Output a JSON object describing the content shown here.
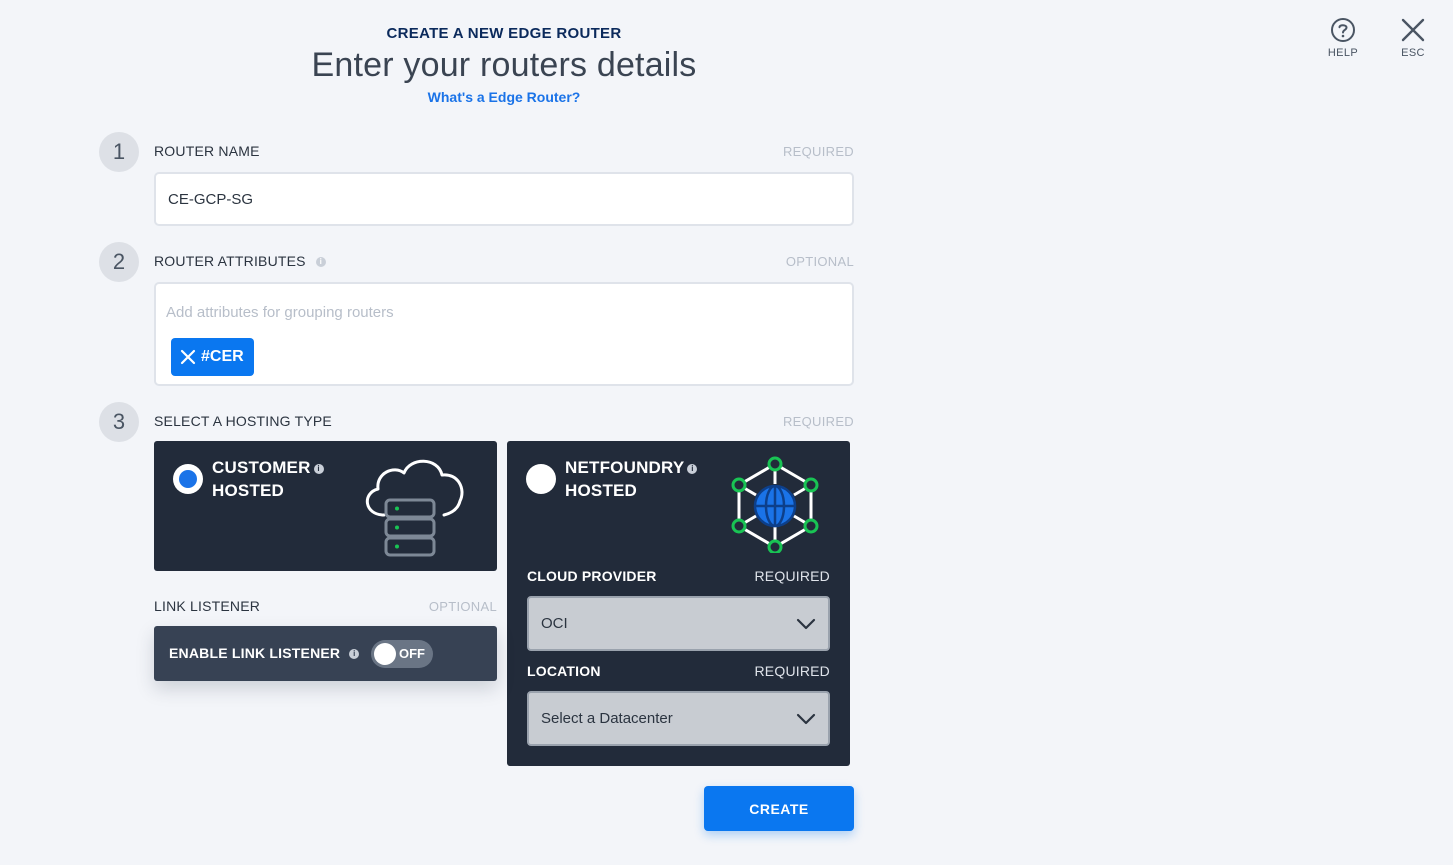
{
  "header": {
    "kicker": "CREATE A NEW EDGE ROUTER",
    "title": "Enter your routers details",
    "help_link": "What's a Edge Router?"
  },
  "corner": {
    "help_label": "HELP",
    "esc_label": "ESC"
  },
  "steps": [
    {
      "number": "1",
      "label": "ROUTER NAME",
      "requirement": "REQUIRED"
    },
    {
      "number": "2",
      "label": "ROUTER ATTRIBUTES",
      "requirement": "OPTIONAL"
    },
    {
      "number": "3",
      "label": "SELECT A HOSTING TYPE",
      "requirement": "REQUIRED"
    }
  ],
  "router_name": {
    "value": "CE-GCP-SG"
  },
  "attributes": {
    "placeholder": "Add attributes for grouping routers",
    "chips": [
      "#CER"
    ]
  },
  "hosting": {
    "customer": {
      "line1": "CUSTOMER",
      "line2": "HOSTED",
      "selected": true
    },
    "netfoundry": {
      "line1": "NETFOUNDRY",
      "line2": "HOSTED",
      "selected": false,
      "cloud_provider_label": "CLOUD PROVIDER",
      "cloud_provider_req": "REQUIRED",
      "cloud_provider_value": "OCI",
      "location_label": "LOCATION",
      "location_req": "REQUIRED",
      "location_value": "Select a Datacenter"
    }
  },
  "link_listener": {
    "label": "LINK LISTENER",
    "requirement": "OPTIONAL",
    "toggle_label": "ENABLE LINK LISTENER",
    "toggle_state": "OFF"
  },
  "actions": {
    "create_label": "CREATE"
  },
  "colors": {
    "accent": "#0a77f0",
    "card_bg": "#222b3a",
    "network_green": "#19c454"
  },
  "icons": [
    "help-icon",
    "close-icon",
    "info-icon",
    "cloud-server-icon",
    "network-globe-icon",
    "chevron-down-icon"
  ]
}
